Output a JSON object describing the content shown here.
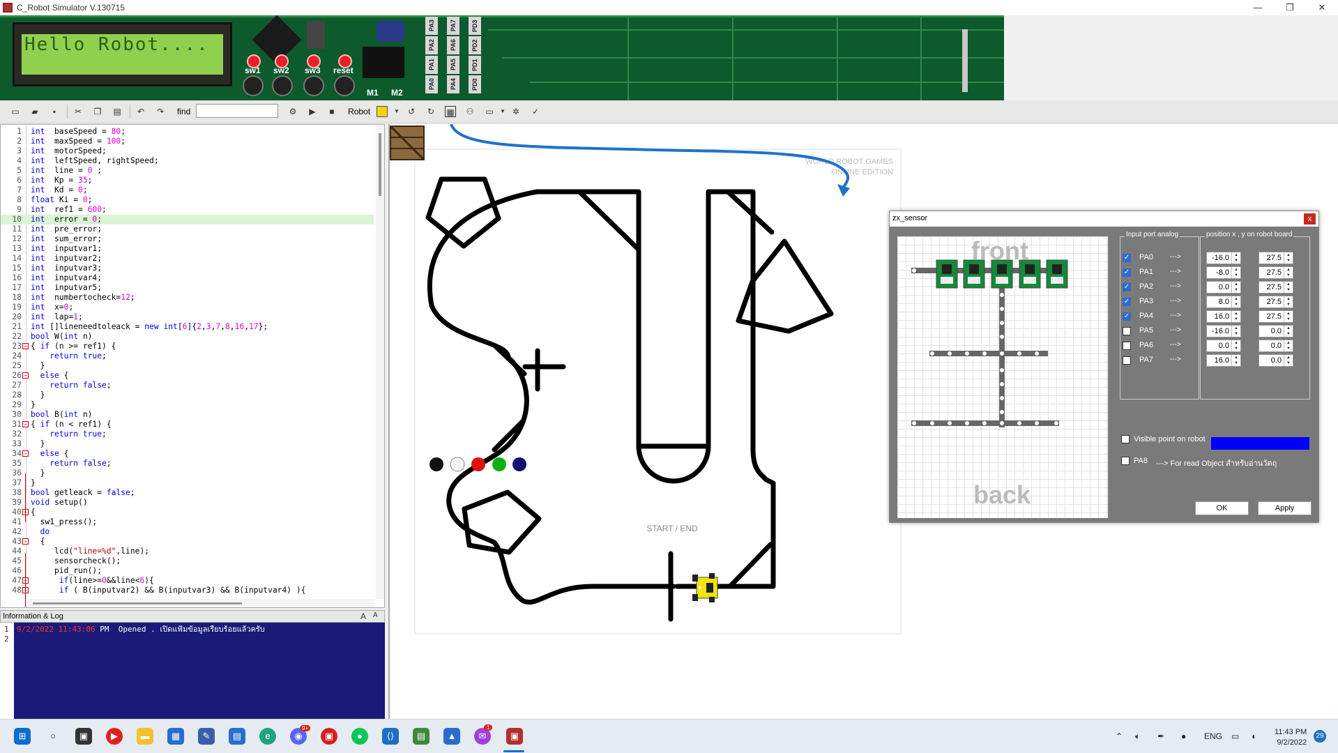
{
  "window": {
    "title": "C_Robot Simulator V.130715",
    "minimize": "—",
    "maximize": "❐",
    "close": "✕"
  },
  "board": {
    "lcd_text": "Hello Robot....",
    "switches": [
      "sw1",
      "sw2",
      "sw3",
      "reset"
    ],
    "motors": [
      "M1",
      "M2"
    ],
    "ports_top": [
      "PA3",
      "PA2",
      "PA1",
      "PA0"
    ],
    "ports_mid": [
      "PA7",
      "PA6",
      "PA5",
      "PA4"
    ],
    "ports_right": [
      "PD3",
      "PD2",
      "PD1",
      "PD0"
    ]
  },
  "toolbar": {
    "find_label": "find",
    "robot_label": "Robot",
    "find_value": ""
  },
  "code": [
    {
      "ln": "1",
      "t": [
        [
          "kw",
          "int"
        ],
        [
          "",
          "  baseSpeed = "
        ],
        [
          "num",
          "80"
        ],
        [
          "",
          ";"
        ]
      ]
    },
    {
      "ln": "2",
      "t": [
        [
          "kw",
          "int"
        ],
        [
          "",
          "  maxSpeed = "
        ],
        [
          "num",
          "100"
        ],
        [
          "",
          ";"
        ]
      ]
    },
    {
      "ln": "3",
      "t": [
        [
          "kw",
          "int"
        ],
        [
          "",
          "  motorSpeed;"
        ]
      ]
    },
    {
      "ln": "4",
      "t": [
        [
          "kw",
          "int"
        ],
        [
          "",
          "  leftSpeed, rightSpeed;"
        ]
      ]
    },
    {
      "ln": "5",
      "t": [
        [
          "kw",
          "int"
        ],
        [
          "",
          "  line = "
        ],
        [
          "num",
          "0"
        ],
        [
          "",
          " ;"
        ]
      ]
    },
    {
      "ln": "6",
      "t": [
        [
          "kw",
          "int"
        ],
        [
          "",
          "  Kp = "
        ],
        [
          "num",
          "35"
        ],
        [
          "",
          ";"
        ]
      ]
    },
    {
      "ln": "7",
      "t": [
        [
          "kw",
          "int"
        ],
        [
          "",
          "  Kd = "
        ],
        [
          "num",
          "0"
        ],
        [
          "",
          ";"
        ]
      ]
    },
    {
      "ln": "8",
      "t": [
        [
          "kw",
          "float"
        ],
        [
          "",
          " Ki = "
        ],
        [
          "num",
          "0"
        ],
        [
          "",
          ";"
        ]
      ]
    },
    {
      "ln": "9",
      "t": [
        [
          "kw",
          "int"
        ],
        [
          "",
          "  ref1 = "
        ],
        [
          "num",
          "600"
        ],
        [
          "",
          ";"
        ]
      ]
    },
    {
      "ln": "10",
      "t": [
        [
          "kw",
          "int"
        ],
        [
          "",
          "  error = "
        ],
        [
          "num",
          "0"
        ],
        [
          "",
          ";"
        ]
      ],
      "hl": true
    },
    {
      "ln": "11",
      "t": [
        [
          "kw",
          "int"
        ],
        [
          "",
          "  pre_error;"
        ]
      ]
    },
    {
      "ln": "12",
      "t": [
        [
          "kw",
          "int"
        ],
        [
          "",
          "  sum_error;"
        ]
      ]
    },
    {
      "ln": "13",
      "t": [
        [
          "kw",
          "int"
        ],
        [
          "",
          "  inputvar1;"
        ]
      ]
    },
    {
      "ln": "14",
      "t": [
        [
          "kw",
          "int"
        ],
        [
          "",
          "  inputvar2;"
        ]
      ]
    },
    {
      "ln": "15",
      "t": [
        [
          "kw",
          "int"
        ],
        [
          "",
          "  inputvar3;"
        ]
      ]
    },
    {
      "ln": "16",
      "t": [
        [
          "kw",
          "int"
        ],
        [
          "",
          "  inputvar4;"
        ]
      ]
    },
    {
      "ln": "17",
      "t": [
        [
          "kw",
          "int"
        ],
        [
          "",
          "  inputvar5;"
        ]
      ]
    },
    {
      "ln": "18",
      "t": [
        [
          "kw",
          "int"
        ],
        [
          "",
          "  numbertocheck="
        ],
        [
          "num",
          "12"
        ],
        [
          "",
          ";"
        ]
      ]
    },
    {
      "ln": "19",
      "t": [
        [
          "kw",
          "int"
        ],
        [
          "",
          "  x="
        ],
        [
          "num",
          "0"
        ],
        [
          "",
          ";"
        ]
      ]
    },
    {
      "ln": "20",
      "t": [
        [
          "kw",
          "int"
        ],
        [
          "",
          "  lap="
        ],
        [
          "num",
          "1"
        ],
        [
          "",
          ";"
        ]
      ]
    },
    {
      "ln": "21",
      "t": [
        [
          "kw",
          "int"
        ],
        [
          "",
          " []lineneedtoleack = "
        ],
        [
          "kw",
          "new int"
        ],
        [
          "",
          "["
        ],
        [
          "num",
          "6"
        ],
        [
          "",
          "]{"
        ],
        [
          "num",
          "2"
        ],
        [
          "",
          ","
        ],
        [
          "num",
          "3"
        ],
        [
          "",
          ","
        ],
        [
          "num",
          "7"
        ],
        [
          "",
          ","
        ],
        [
          "num",
          "8"
        ],
        [
          "",
          ","
        ],
        [
          "num",
          "16"
        ],
        [
          "",
          ","
        ],
        [
          "num",
          "17"
        ],
        [
          "",
          "};"
        ]
      ]
    },
    {
      "ln": "22",
      "t": [
        [
          "kw",
          "bool"
        ],
        [
          "",
          " W("
        ],
        [
          "kw",
          "int"
        ],
        [
          "",
          " n)"
        ]
      ]
    },
    {
      "ln": "23",
      "t": [
        [
          "",
          "{ "
        ],
        [
          "kw",
          "if"
        ],
        [
          "",
          " (n >= ref1) {"
        ]
      ],
      "fold": true
    },
    {
      "ln": "24",
      "t": [
        [
          "",
          "    "
        ],
        [
          "kw",
          "return true"
        ],
        [
          "",
          ";"
        ]
      ]
    },
    {
      "ln": "25",
      "t": [
        [
          "",
          "  }"
        ]
      ]
    },
    {
      "ln": "26",
      "t": [
        [
          "",
          "  "
        ],
        [
          "kw",
          "else"
        ],
        [
          "",
          " {"
        ]
      ],
      "fold": true
    },
    {
      "ln": "27",
      "t": [
        [
          "",
          "    "
        ],
        [
          "kw",
          "return false"
        ],
        [
          "",
          ";"
        ]
      ]
    },
    {
      "ln": "28",
      "t": [
        [
          "",
          "  }"
        ]
      ]
    },
    {
      "ln": "29",
      "t": [
        [
          "",
          "}"
        ]
      ]
    },
    {
      "ln": "30",
      "t": [
        [
          "kw",
          "bool"
        ],
        [
          "",
          " B("
        ],
        [
          "kw",
          "int"
        ],
        [
          "",
          " n)"
        ]
      ]
    },
    {
      "ln": "31",
      "t": [
        [
          "",
          "{ "
        ],
        [
          "kw",
          "if"
        ],
        [
          "",
          " (n < ref1) {"
        ]
      ],
      "fold": true
    },
    {
      "ln": "32",
      "t": [
        [
          "",
          "    "
        ],
        [
          "kw",
          "return true"
        ],
        [
          "",
          ";"
        ]
      ]
    },
    {
      "ln": "33",
      "t": [
        [
          "",
          "  }"
        ]
      ]
    },
    {
      "ln": "34",
      "t": [
        [
          "",
          "  "
        ],
        [
          "kw",
          "else"
        ],
        [
          "",
          " {"
        ]
      ],
      "fold": true
    },
    {
      "ln": "35",
      "t": [
        [
          "",
          "    "
        ],
        [
          "kw",
          "return false"
        ],
        [
          "",
          ";"
        ]
      ]
    },
    {
      "ln": "36",
      "t": [
        [
          "",
          "  }"
        ]
      ]
    },
    {
      "ln": "37",
      "t": [
        [
          "",
          "}"
        ]
      ]
    },
    {
      "ln": "38",
      "t": [
        [
          "kw",
          "bool"
        ],
        [
          "",
          " getleack = "
        ],
        [
          "kw",
          "false"
        ],
        [
          "",
          ";"
        ]
      ]
    },
    {
      "ln": "39",
      "t": [
        [
          "kw",
          "void"
        ],
        [
          "",
          " setup()"
        ]
      ]
    },
    {
      "ln": "40",
      "t": [
        [
          "",
          "{"
        ]
      ],
      "fold": true
    },
    {
      "ln": "41",
      "t": [
        [
          "",
          "  sw1_press();"
        ]
      ]
    },
    {
      "ln": "42",
      "t": [
        [
          "",
          "  "
        ],
        [
          "kw",
          "do"
        ]
      ]
    },
    {
      "ln": "43",
      "t": [
        [
          "",
          "  {"
        ]
      ],
      "fold": true
    },
    {
      "ln": "44",
      "t": [
        [
          "",
          "     lcd("
        ],
        [
          "str",
          "\"line=%d\""
        ],
        [
          "",
          ",line);"
        ]
      ]
    },
    {
      "ln": "45",
      "t": [
        [
          "",
          "     sensorcheck();"
        ]
      ]
    },
    {
      "ln": "46",
      "t": [
        [
          "",
          "     pid_run();"
        ]
      ]
    },
    {
      "ln": "47",
      "t": [
        [
          "",
          "      "
        ],
        [
          "kw",
          "if"
        ],
        [
          "",
          "(line>="
        ],
        [
          "num",
          "0"
        ],
        [
          "",
          "&&line<"
        ],
        [
          "num",
          "6"
        ],
        [
          "",
          "){"
        ]
      ],
      "fold": true
    },
    {
      "ln": "48",
      "t": [
        [
          "",
          "      "
        ],
        [
          "kw",
          "if"
        ],
        [
          "",
          " ( B(inputvar2) && B(inputvar3) && B(inputvar4) ){"
        ]
      ],
      "fold": true
    }
  ],
  "info": {
    "title": "Information & Log",
    "lines": [
      {
        "ln": "1",
        "date": "9/2/2022",
        "time": "11:43:06",
        "ampm": "PM",
        "msg": "Opened . เปิดแฟ้มข้อมูลเรียบร้อยแล้วครับ"
      },
      {
        "ln": "2"
      }
    ]
  },
  "sim": {
    "watermark1": "WORLD ROBOT GAMES",
    "watermark2": "ONLINE EDITION",
    "start_label": "START / END"
  },
  "dialog": {
    "title": "zx_sensor",
    "close": "x",
    "front": "front",
    "back": "back",
    "group_input": "Input port analog",
    "group_position": "position x , y on robot board",
    "arrow": "--->",
    "rows": [
      {
        "name": "PA0",
        "checked": true,
        "x": "-16.0",
        "y": "27.5"
      },
      {
        "name": "PA1",
        "checked": true,
        "x": "-8.0",
        "y": "27.5"
      },
      {
        "name": "PA2",
        "checked": true,
        "x": "0.0",
        "y": "27.5"
      },
      {
        "name": "PA3",
        "checked": true,
        "x": "8.0",
        "y": "27.5"
      },
      {
        "name": "PA4",
        "checked": true,
        "x": "16.0",
        "y": "27.5"
      },
      {
        "name": "PA5",
        "checked": false,
        "x": "-16.0",
        "y": "0.0"
      },
      {
        "name": "PA6",
        "checked": false,
        "x": "0.0",
        "y": "0.0"
      },
      {
        "name": "PA7",
        "checked": false,
        "x": "16.0",
        "y": "0.0"
      }
    ],
    "visible_point": "Visible point on robot",
    "visible_color": "#0000ff",
    "pa8": "PA8",
    "pa8_desc": "---> For read Object สำหรับอ่านวัตถุ",
    "ok": "OK",
    "apply": "Apply"
  },
  "taskbar": {
    "lang": "ENG",
    "time": "11:43 PM",
    "date": "9/2/2022",
    "notifications": "29",
    "badge_discord": "9+",
    "badge_messenger": "1"
  }
}
